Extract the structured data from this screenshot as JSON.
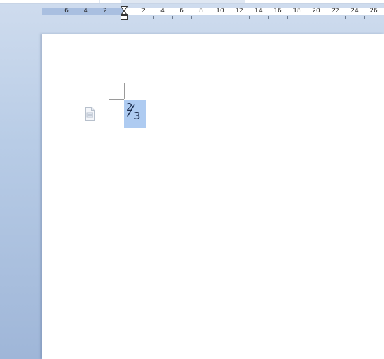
{
  "ruler": {
    "labels": [
      "6",
      "4",
      "2",
      "2",
      "4",
      "6",
      "8",
      "10",
      "12",
      "14",
      "16",
      "18",
      "20",
      "22",
      "24",
      "26"
    ]
  },
  "document": {
    "fraction": {
      "numerator": "2",
      "slash": "⁄",
      "denominator": "3"
    }
  },
  "icons": {
    "indent_marker": "hourglass-indent-marker-icon",
    "paragraph_object": "document-icon"
  },
  "colors": {
    "selection": "#aecbf1",
    "ruler_margin": "#a9bfe0",
    "background": "#b8cce6"
  }
}
